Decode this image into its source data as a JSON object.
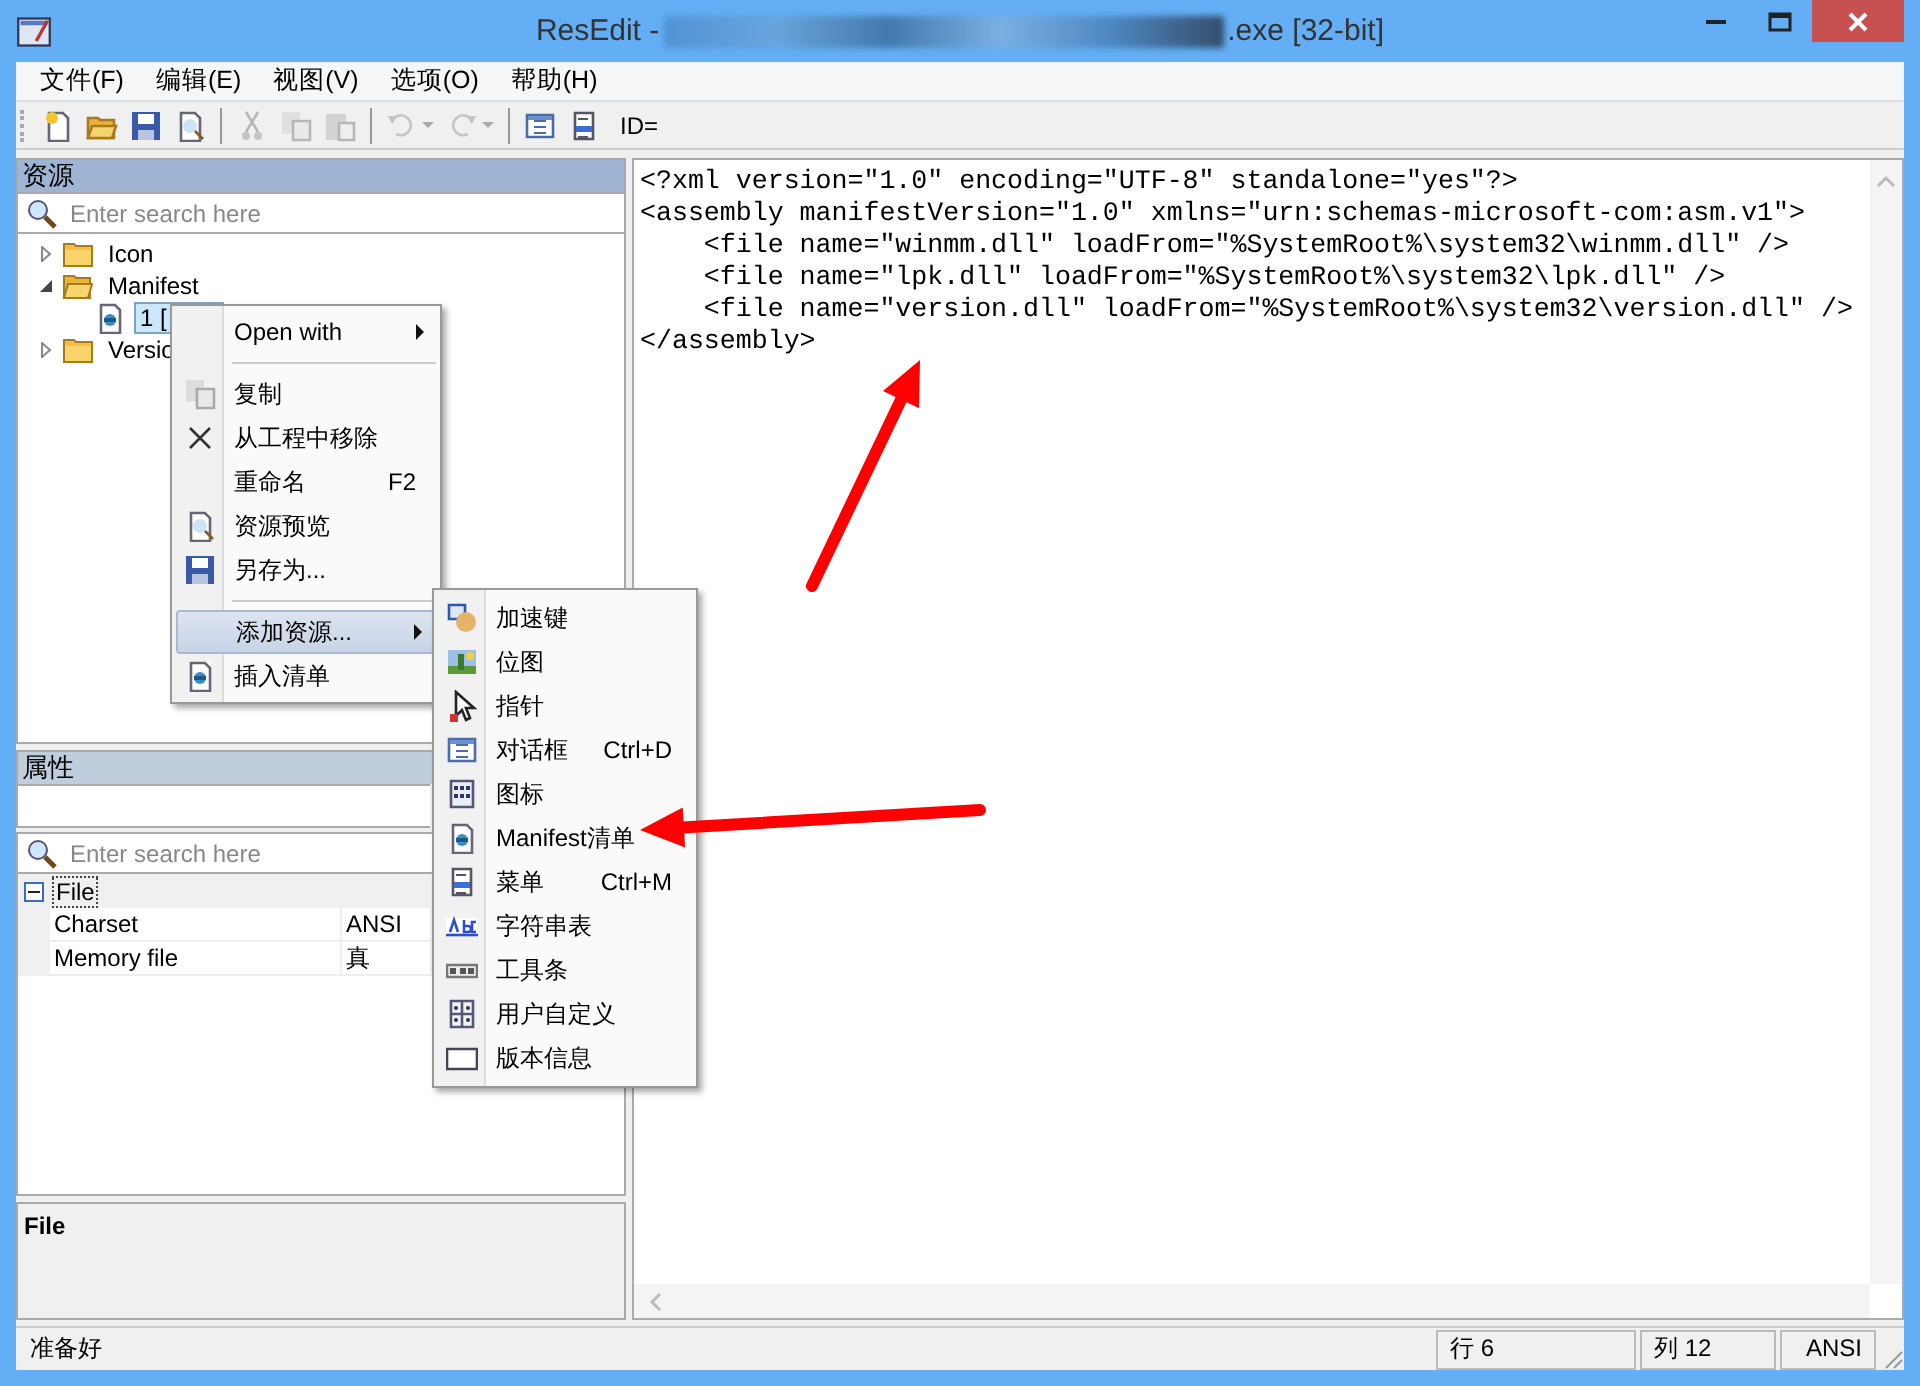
{
  "window": {
    "title_start": "ResEdit -",
    "title_redacted": true,
    "title_end": ".exe [32-bit]"
  },
  "menu_bar": [
    "文件(F)",
    "编辑(E)",
    "视图(V)",
    "选项(O)",
    "帮助(H)"
  ],
  "toolbar": [
    {
      "kind": "button",
      "disabled": false
    },
    {
      "kind": "button",
      "disabled": false
    },
    {
      "kind": "button",
      "disabled": false
    },
    {
      "kind": "button",
      "disabled": false
    },
    {
      "kind": "separator"
    },
    {
      "kind": "button",
      "disabled": true
    },
    {
      "kind": "button",
      "disabled": true
    },
    {
      "kind": "button",
      "disabled": true
    },
    {
      "kind": "separator"
    },
    {
      "kind": "split",
      "disabled": true
    },
    {
      "kind": "split",
      "disabled": true
    },
    {
      "kind": "separator"
    },
    {
      "kind": "button",
      "disabled": false
    },
    {
      "kind": "button",
      "disabled": false
    },
    {
      "kind": "label",
      "text": "ID="
    }
  ],
  "resources": {
    "header": "资源",
    "search": {
      "placeholder": "Enter search here"
    },
    "tree": [
      {
        "kind": "folder",
        "label": "Icon",
        "expanded": false
      },
      {
        "kind": "folder",
        "label": "Manifest",
        "expanded": true,
        "children": [
          {
            "kind": "resource",
            "label": "1 [",
            "selected": true
          }
        ]
      },
      {
        "kind": "folder",
        "label": "Versio",
        "expanded": false
      }
    ]
  },
  "properties": {
    "header": "属性",
    "search": {
      "placeholder": "Enter search here"
    },
    "group": {
      "label": "File",
      "expanded": true,
      "rows": [
        {
          "name": "Charset",
          "value": "ANSI"
        },
        {
          "name": "Memory file",
          "value": "真"
        }
      ]
    },
    "description": "File"
  },
  "editor": {
    "lines": [
      "<?xml version=\"1.0\" encoding=\"UTF-8\" standalone=\"yes\"?>",
      "<assembly manifestVersion=\"1.0\" xmlns=\"urn:schemas-microsoft-com:asm.v1\">",
      "    <file name=\"winmm.dll\" loadFrom=\"%SystemRoot%\\system32\\winmm.dll\" />",
      "    <file name=\"lpk.dll\" loadFrom=\"%SystemRoot%\\system32\\lpk.dll\" />",
      "    <file name=\"version.dll\" loadFrom=\"%SystemRoot%\\system32\\version.dll\" />",
      "</assembly>"
    ]
  },
  "context_menu": [
    {
      "kind": "item",
      "label": "Open with",
      "submenu": true,
      "selected": false
    },
    {
      "kind": "separator"
    },
    {
      "kind": "item",
      "label": "复制",
      "submenu": false,
      "selected": false
    },
    {
      "kind": "item",
      "label": "从工程中移除",
      "submenu": false,
      "selected": false
    },
    {
      "kind": "item",
      "label": "重命名",
      "shortcut": "F2",
      "submenu": false,
      "selected": false
    },
    {
      "kind": "item",
      "label": "资源预览",
      "submenu": false,
      "selected": false
    },
    {
      "kind": "item",
      "label": "另存为...",
      "submenu": false,
      "selected": false
    },
    {
      "kind": "separator"
    },
    {
      "kind": "item",
      "label": "添加资源...",
      "submenu": true,
      "selected": true
    },
    {
      "kind": "item",
      "label": "插入清单",
      "submenu": false,
      "selected": false
    }
  ],
  "submenu": [
    {
      "label": "加速键"
    },
    {
      "label": "位图"
    },
    {
      "label": "指针"
    },
    {
      "label": "对话框",
      "shortcut": "Ctrl+D"
    },
    {
      "label": "图标"
    },
    {
      "label": "Manifest清单"
    },
    {
      "label": "菜单",
      "shortcut": "Ctrl+M"
    },
    {
      "label": "字符串表"
    },
    {
      "label": "工具条"
    },
    {
      "label": "用户自定义"
    },
    {
      "label": "版本信息"
    }
  ],
  "annotations": [
    {
      "kind": "arrow"
    },
    {
      "kind": "arrow"
    }
  ],
  "status_bar": [
    "准备好",
    "行 6",
    "列 12",
    "ANSI"
  ]
}
